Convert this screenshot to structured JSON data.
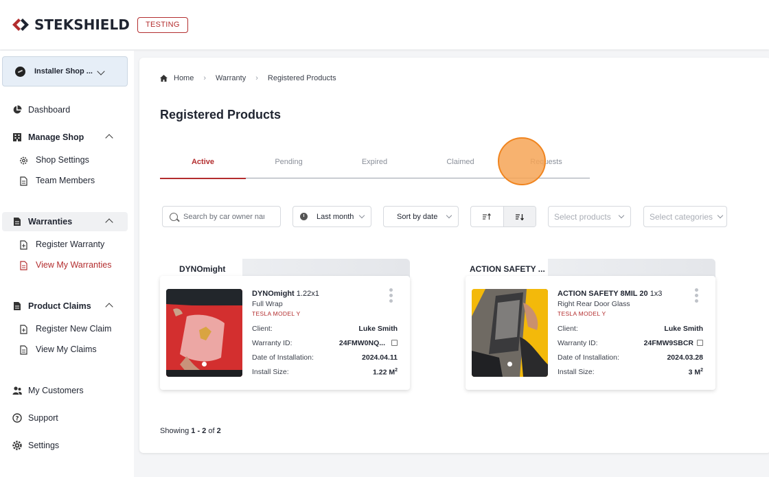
{
  "header": {
    "brand": "STEKSHIELD",
    "env_badge": "TESTING"
  },
  "sidebar": {
    "shop_name": "Installer Shop ...",
    "items": [
      {
        "label": "Dashboard",
        "icon": "pie-chart-icon"
      },
      {
        "label": "Manage Shop",
        "icon": "building-icon"
      },
      {
        "label": "Shop Settings",
        "icon": "gear-icon"
      },
      {
        "label": "Team Members",
        "icon": "document-icon"
      },
      {
        "label": "Warranties",
        "icon": "document-icon"
      },
      {
        "label": "Register Warranty",
        "icon": "document-plus-icon"
      },
      {
        "label": "View My Warranties",
        "icon": "document-icon"
      },
      {
        "label": "Product Claims",
        "icon": "document-icon"
      },
      {
        "label": "Register New Claim",
        "icon": "document-plus-icon"
      },
      {
        "label": "View My Claims",
        "icon": "document-icon"
      },
      {
        "label": "My Customers",
        "icon": "users-icon"
      },
      {
        "label": "Support",
        "icon": "help-icon"
      },
      {
        "label": "Settings",
        "icon": "gear-icon"
      }
    ]
  },
  "breadcrumb": {
    "home": "Home",
    "level1": "Warranty",
    "level2": "Registered Products"
  },
  "page_title": "Registered Products",
  "tabs": [
    "Active",
    "Pending",
    "Expired",
    "Claimed",
    "Requests"
  ],
  "filters": {
    "search_placeholder": "Search by car owner name",
    "period": "Last month",
    "sort": "Sort by date",
    "products_placeholder": "Select products",
    "categories_placeholder": "Select categories"
  },
  "cards": [
    {
      "group": "DYNOmight",
      "product": "DYNOmight",
      "size_label": "1.22x1",
      "coverage": "Full Wrap",
      "car": "TESLA MODEL Y",
      "client_label": "Client:",
      "client": "Luke Smith",
      "warranty_label": "Warranty ID:",
      "warranty_id": "24FMW0NQ...",
      "date_label": "Date of Installation:",
      "date": "2024.04.11",
      "install_label": "Install Size:",
      "install_size": "1.22 M",
      "unit_sup": "2"
    },
    {
      "group": "ACTION SAFETY ...",
      "product": "ACTION SAFETY 8MIL 20",
      "size_label": "1x3",
      "coverage": "Right Rear Door Glass",
      "car": "TESLA MODEL Y",
      "client_label": "Client:",
      "client": "Luke Smith",
      "warranty_label": "Warranty ID:",
      "warranty_id": "24FMW9SBCR",
      "date_label": "Date of Installation:",
      "date": "2024.03.28",
      "install_label": "Install Size:",
      "install_size": "3 M",
      "unit_sup": "2"
    }
  ],
  "footer": {
    "prefix": "Showing",
    "range": "1 - 2",
    "of": "of",
    "total": "2"
  },
  "colors": {
    "accent": "#b32d2e",
    "click_indicator": "#f0841e"
  }
}
